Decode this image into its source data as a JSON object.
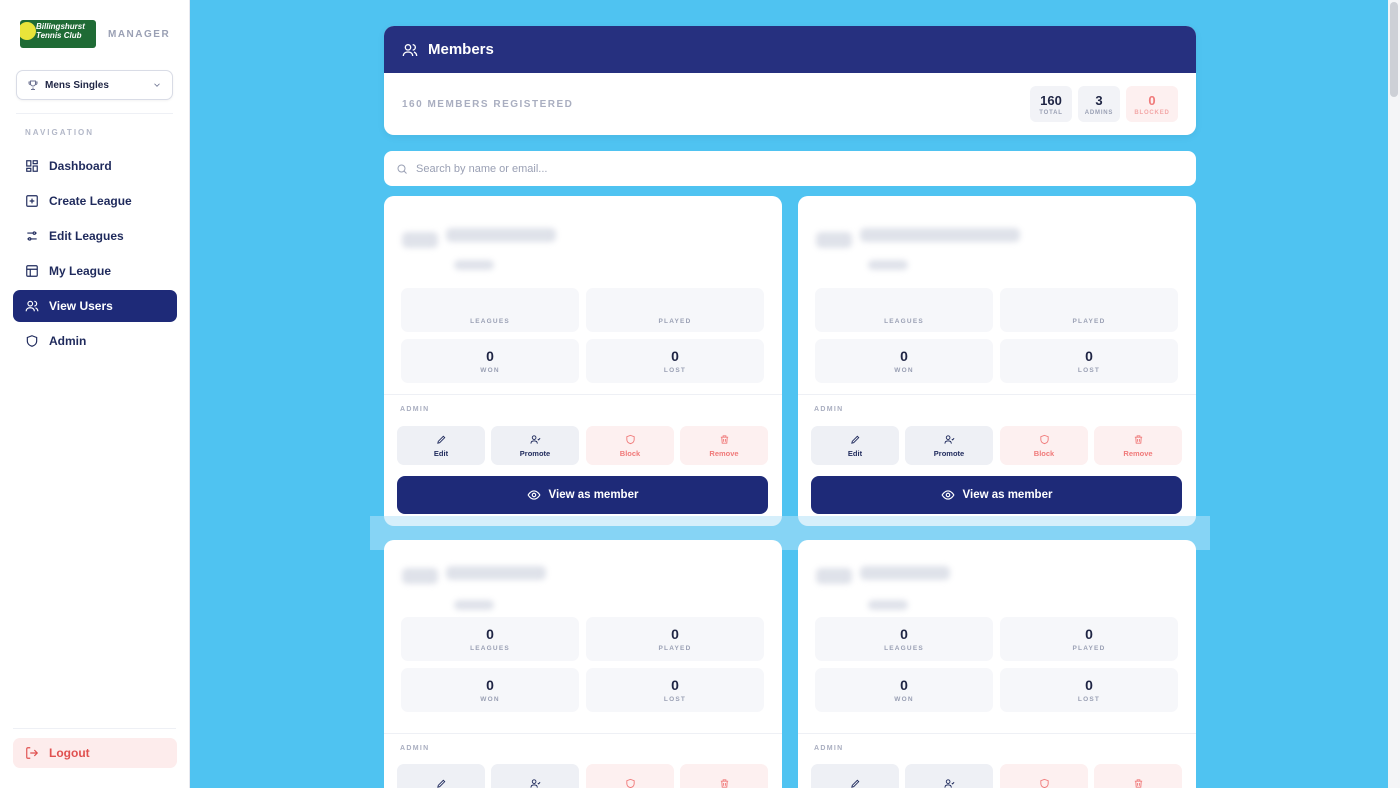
{
  "sidebar": {
    "logo_text": "Billingshurst Tennis Club",
    "role": "MANAGER",
    "league_select": "Mens Singles",
    "nav_title": "NAVIGATION",
    "items": [
      {
        "label": "Dashboard",
        "icon": "dashboard-icon"
      },
      {
        "label": "Create League",
        "icon": "plus-square-icon"
      },
      {
        "label": "Edit Leagues",
        "icon": "sliders-icon"
      },
      {
        "label": "My League",
        "icon": "table-icon"
      },
      {
        "label": "View Users",
        "icon": "users-icon",
        "active": true
      },
      {
        "label": "Admin",
        "icon": "shield-icon"
      }
    ],
    "logout": "Logout"
  },
  "header": {
    "title": "Members",
    "registered": "160 MEMBERS REGISTERED",
    "stats": [
      {
        "value": "160",
        "label": "TOTAL"
      },
      {
        "value": "3",
        "label": "ADMINS"
      },
      {
        "value": "0",
        "label": "BLOCKED"
      }
    ]
  },
  "search": {
    "placeholder": "Search by name or email..."
  },
  "cards": [
    {
      "stats": [
        {
          "value": "",
          "label": "LEAGUES"
        },
        {
          "value": "",
          "label": "PLAYED"
        },
        {
          "value": "0",
          "label": "WON"
        },
        {
          "value": "0",
          "label": "LOST"
        }
      ],
      "role": "ADMIN",
      "actions": [
        "Edit",
        "Promote",
        "Block",
        "Remove"
      ],
      "view_label": "View as member"
    },
    {
      "stats": [
        {
          "value": "",
          "label": "LEAGUES"
        },
        {
          "value": "",
          "label": "PLAYED"
        },
        {
          "value": "0",
          "label": "WON"
        },
        {
          "value": "0",
          "label": "LOST"
        }
      ],
      "role": "ADMIN",
      "actions": [
        "Edit",
        "Promote",
        "Block",
        "Remove"
      ],
      "view_label": "View as member"
    },
    {
      "stats": [
        {
          "value": "0",
          "label": "LEAGUES"
        },
        {
          "value": "0",
          "label": "PLAYED"
        },
        {
          "value": "0",
          "label": "WON"
        },
        {
          "value": "0",
          "label": "LOST"
        }
      ],
      "role": "ADMIN"
    },
    {
      "stats": [
        {
          "value": "0",
          "label": "LEAGUES"
        },
        {
          "value": "0",
          "label": "PLAYED"
        },
        {
          "value": "0",
          "label": "WON"
        },
        {
          "value": "0",
          "label": "LOST"
        }
      ],
      "role": "ADMIN"
    }
  ],
  "colors": {
    "background": "#4fc3f1",
    "primary": "#1e2a78",
    "header": "#26307f",
    "danger": "#f07a7a"
  }
}
